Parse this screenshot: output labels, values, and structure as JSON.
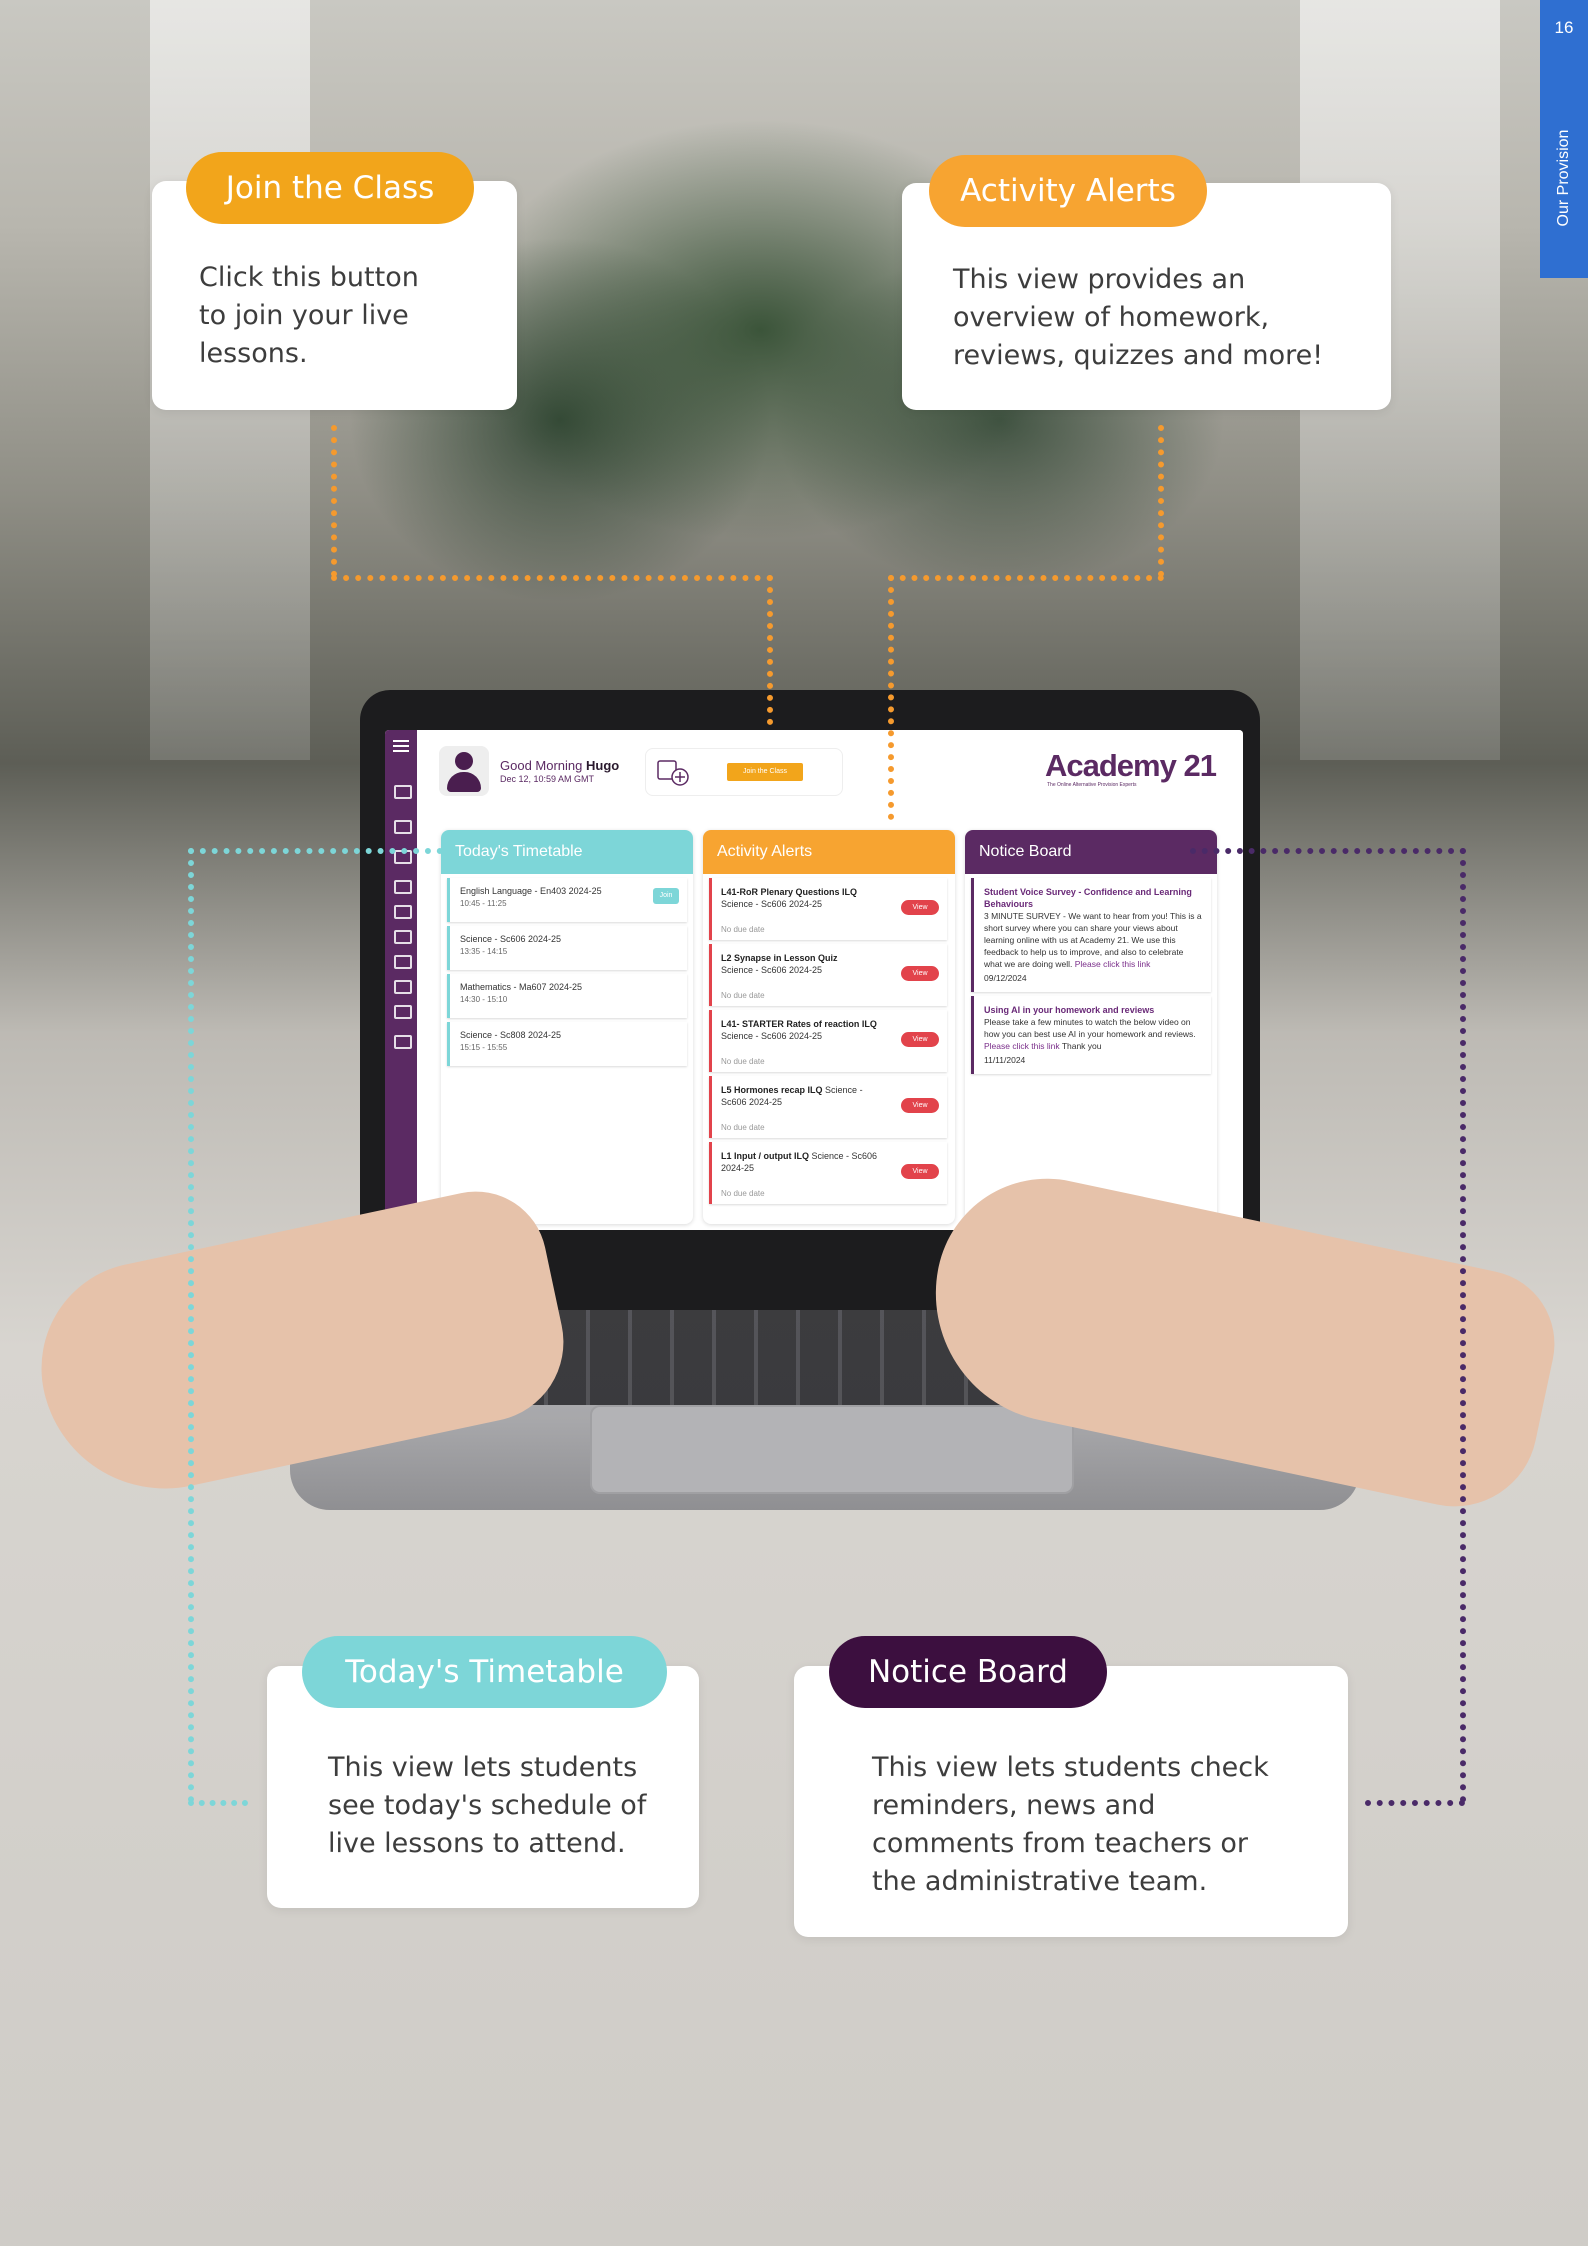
{
  "page": {
    "number": "16",
    "section": "Our Provision"
  },
  "callouts": {
    "join": {
      "label": "Join the Class",
      "text": "Click this button to join your live lessons.",
      "color": "#f2a51b"
    },
    "alerts": {
      "label": "Activity Alerts",
      "text": "This view provides an overview of homework, reviews, quizzes and more!",
      "color": "#f7a431"
    },
    "timetable": {
      "label": "Today's Timetable",
      "text": "This view lets students see today's schedule of live lessons to attend.",
      "color": "#7dd6d8"
    },
    "notice": {
      "label": "Notice Board",
      "text": "This view lets students check reminders, news and comments from teachers or the administrative team.",
      "color": "#3c0f3f"
    }
  },
  "dashboard": {
    "greeting": "Good Morning",
    "user": "Hugo",
    "datetime": "Dec 12, 10:59 AM GMT",
    "join_button": "Join the Class",
    "logo": "Academy 21",
    "logo_sub": "The Online Alternative Provision Experts",
    "timetable": {
      "title": "Today's Timetable",
      "join_label": "Join",
      "items": [
        {
          "subject": "English Language - En403 2024-25",
          "time": "10:45 - 11:25"
        },
        {
          "subject": "Science - Sc606 2024-25",
          "time": "13:35 - 14:15"
        },
        {
          "subject": "Mathematics - Ma607 2024-25",
          "time": "14:30 - 15:10"
        },
        {
          "subject": "Science - Sc808 2024-25",
          "time": "15:15 - 15:55"
        }
      ]
    },
    "alerts": {
      "title": "Activity Alerts",
      "view_label": "View",
      "items": [
        {
          "title": "L41-RoR Plenary Questions ILQ",
          "course": "Science - Sc606 2024-25",
          "due": "No due date"
        },
        {
          "title": "L2 Synapse in Lesson Quiz",
          "course": "Science - Sc606 2024-25",
          "due": "No due date"
        },
        {
          "title": "L41- STARTER Rates of reaction ILQ",
          "course": "Science - Sc606 2024-25",
          "due": "No due date"
        },
        {
          "title": "L5 Hormones recap ILQ",
          "course": "Science - Sc606 2024-25",
          "due": "No due date"
        },
        {
          "title": "L1 Input / output ILQ",
          "course": "Science - Sc606 2024-25",
          "due": "No due date"
        }
      ]
    },
    "notice": {
      "title": "Notice Board",
      "items": [
        {
          "heading": "Student Voice Survey - Confidence and Learning Behaviours",
          "body": "3 MINUTE SURVEY - We want to hear from you! This is a short survey where you can share your views about learning online with us at Academy 21. We use this feedback to help us to improve, and also to celebrate what we are doing well.",
          "link": "Please click this link",
          "date": "09/12/2024"
        },
        {
          "heading": "Using AI in your homework and reviews",
          "body": "Please take a few minutes to watch the below video on how you can best use AI in your homework and reviews.",
          "link": "Please click this link",
          "tail": "Thank you",
          "date": "11/11/2024"
        }
      ]
    }
  }
}
